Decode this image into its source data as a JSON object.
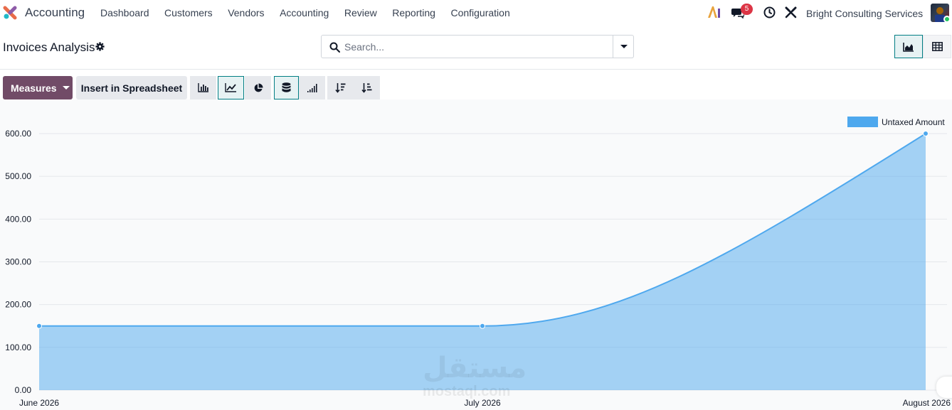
{
  "navbar": {
    "app_name": "Accounting",
    "menu": [
      "Dashboard",
      "Customers",
      "Vendors",
      "Accounting",
      "Review",
      "Reporting",
      "Configuration"
    ],
    "chat_badge": "5",
    "company": "Bright Consulting Services"
  },
  "control_panel": {
    "title": "Invoices Analysis",
    "search_placeholder": "Search..."
  },
  "toolbar": {
    "measures_label": "Measures",
    "insert_label": "Insert in Spreadsheet"
  },
  "colors": {
    "brand": "#714b67",
    "accent": "#017e84",
    "series": "#4ea8ee",
    "badge": "#dc3545"
  },
  "watermark": {
    "text": "مستقل",
    "sub": "mostaql.com"
  },
  "chart_data": {
    "type": "area",
    "categories": [
      "June 2026",
      "July 2026",
      "August 2026"
    ],
    "series": [
      {
        "name": "Untaxed Amount",
        "values": [
          150,
          150,
          600
        ]
      }
    ],
    "ylim": [
      0,
      600
    ],
    "yticks": [
      "0.00",
      "100.00",
      "200.00",
      "300.00",
      "400.00",
      "500.00",
      "600.00"
    ],
    "grid": true,
    "legend": "top-right",
    "title": "",
    "xlabel": "",
    "ylabel": ""
  }
}
